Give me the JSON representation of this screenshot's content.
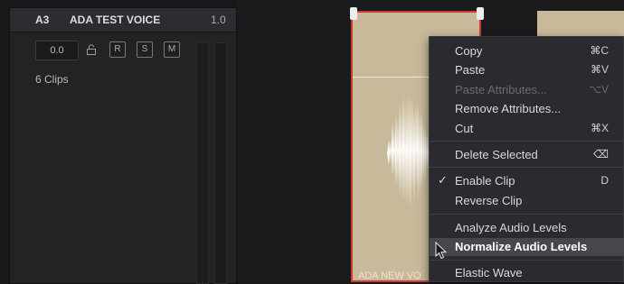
{
  "track": {
    "id": "A3",
    "name": "ADA TEST VOICE",
    "level": "1.0",
    "volume": "0.0",
    "buttons": [
      "R",
      "S",
      "M"
    ],
    "clip_count": "6 Clips"
  },
  "clip": {
    "label": "ADA NEW VO"
  },
  "menu": {
    "items": [
      {
        "label": "Copy",
        "shortcut": "⌘C",
        "enabled": true
      },
      {
        "label": "Paste",
        "shortcut": "⌘V",
        "enabled": true
      },
      {
        "label": "Paste Attributes...",
        "shortcut": "⌥V",
        "enabled": false
      },
      {
        "label": "Remove Attributes...",
        "shortcut": "",
        "enabled": true
      },
      {
        "label": "Cut",
        "shortcut": "⌘X",
        "enabled": true
      },
      {
        "label": "Delete Selected",
        "shortcut": "⌫",
        "enabled": true
      },
      {
        "label": "Enable Clip",
        "shortcut": "D",
        "enabled": true,
        "checked": true
      },
      {
        "label": "Reverse Clip",
        "shortcut": "",
        "enabled": true
      },
      {
        "label": "Analyze Audio Levels",
        "shortcut": "",
        "enabled": true
      },
      {
        "label": "Normalize Audio Levels",
        "shortcut": "",
        "enabled": true,
        "highlighted": true
      },
      {
        "label": "Elastic Wave",
        "shortcut": "",
        "enabled": true
      }
    ]
  },
  "colors": {
    "clip_fill": "#c8b99a",
    "selection_border": "#d23a35",
    "menu_bg": "#2b2b2f"
  }
}
